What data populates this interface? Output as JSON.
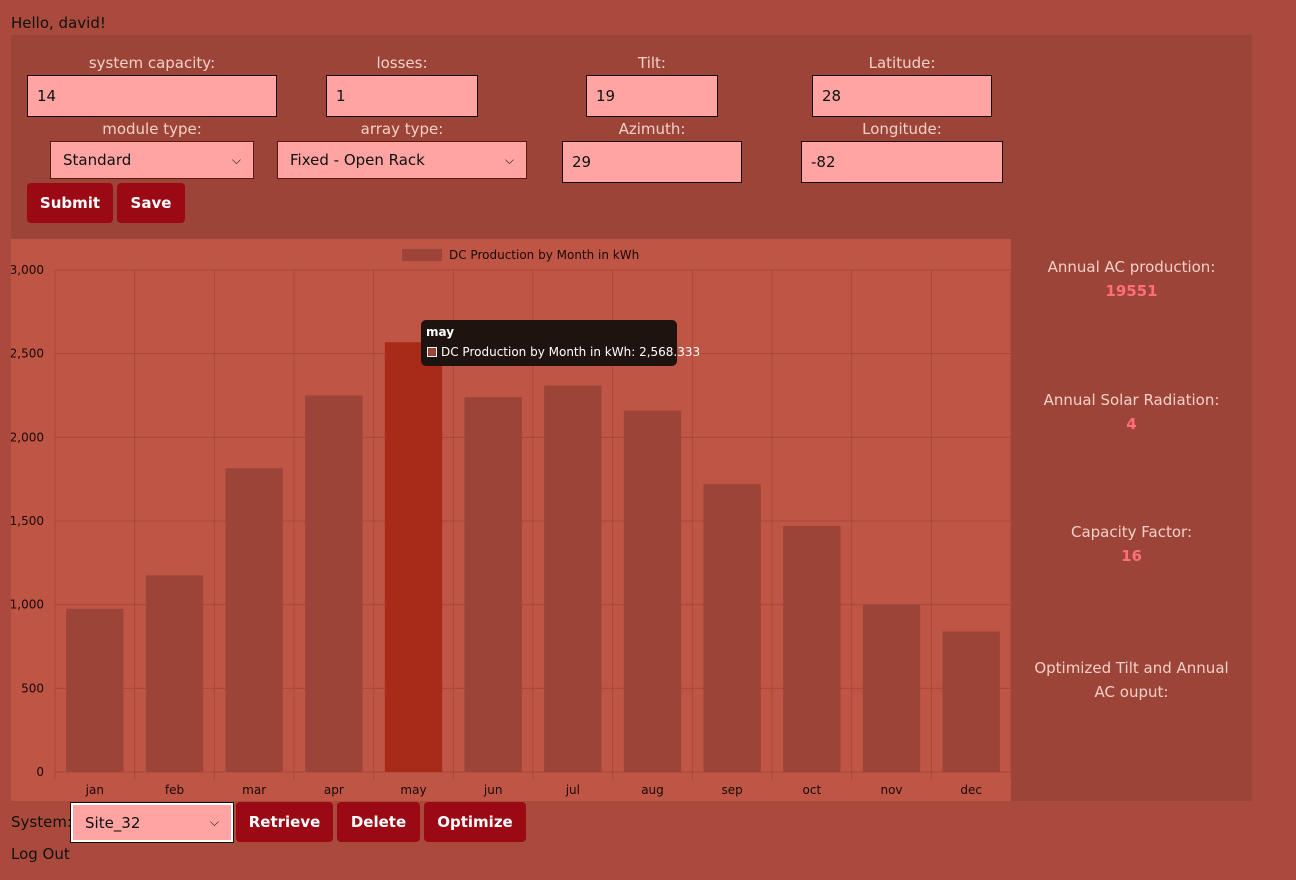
{
  "greeting": "Hello, david!",
  "form": {
    "system_capacity": {
      "label": "system capacity:",
      "value": "14"
    },
    "losses": {
      "label": "losses:",
      "value": "1"
    },
    "tilt": {
      "label": "Tilt:",
      "value": "19"
    },
    "latitude": {
      "label": "Latitude:",
      "value": "28"
    },
    "module_type": {
      "label": "module type:",
      "value": "Standard"
    },
    "array_type": {
      "label": "array type:",
      "value": "Fixed - Open Rack"
    },
    "azimuth": {
      "label": "Azimuth:",
      "value": "29"
    },
    "longitude": {
      "label": "Longitude:",
      "value": "-82"
    },
    "submit_label": "Submit",
    "save_label": "Save"
  },
  "stats": {
    "annual_ac_label": "Annual AC production:",
    "annual_ac_value": "19551",
    "solar_radiation_label": "Annual Solar Radiation:",
    "solar_radiation_value": "4",
    "capacity_factor_label": "Capacity Factor:",
    "capacity_factor_value": "16",
    "optimized_label": "Optimized Tilt and Annual AC ouput:"
  },
  "system": {
    "label": "System:",
    "selected": "Site_32",
    "retrieve_label": "Retrieve",
    "delete_label": "Delete",
    "optimize_label": "Optimize"
  },
  "logout_label": "Log Out",
  "tooltip": {
    "title": "may",
    "text": "DC Production by Month in kWh: 2,568.333"
  },
  "colors": {
    "bar": "#9c4437",
    "bar_highlight": "#a82a18",
    "button": "#9b0a14",
    "input": "#ffa3a3",
    "stat_value": "#ff6f7a"
  },
  "chart_data": {
    "type": "bar",
    "categories": [
      "jan",
      "feb",
      "mar",
      "apr",
      "may",
      "jun",
      "jul",
      "aug",
      "sep",
      "oct",
      "nov",
      "dec"
    ],
    "series": [
      {
        "name": "DC Production by Month in kWh",
        "values": [
          975,
          1175,
          1815,
          2250,
          2568.333,
          2240,
          2310,
          2160,
          1720,
          1470,
          1000,
          840
        ]
      }
    ],
    "highlighted": "may",
    "ylim": [
      0,
      3000
    ],
    "yticks": [
      0,
      500,
      1000,
      1500,
      2000,
      2500,
      3000
    ],
    "ytick_labels": [
      "0",
      "500",
      "1,000",
      "1,500",
      "2,000",
      "2,500",
      "3,000"
    ],
    "grid": true,
    "legend": "top-center"
  }
}
